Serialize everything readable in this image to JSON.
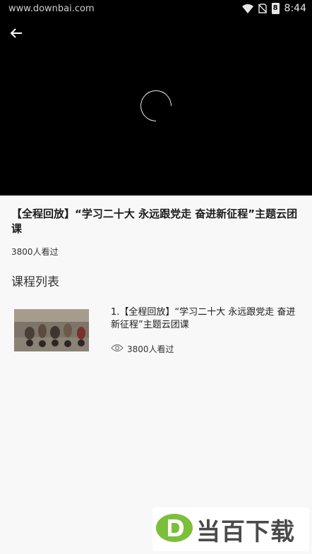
{
  "status_bar": {
    "url": "www.downbai.com",
    "battery_level": "8",
    "time": "8:44"
  },
  "player": {
    "back_icon": "arrow-left-icon",
    "loading_icon": "spinner-icon"
  },
  "course": {
    "title": "【全程回放】“学习二十大 永远跟党走 奋进新征程”主题云团课",
    "views": "3800人看过"
  },
  "course_list": {
    "heading": "课程列表",
    "items": [
      {
        "title": "1.【全程回放】“学习二十大 永远跟党走 奋进新征程”主题云团课",
        "views": "3800人看过"
      }
    ]
  },
  "watermark": {
    "text": "当百下载"
  },
  "colors": {
    "player_background": "#000000",
    "page_background": "#f8f8f8",
    "watermark_green": "#7bbf3a"
  }
}
